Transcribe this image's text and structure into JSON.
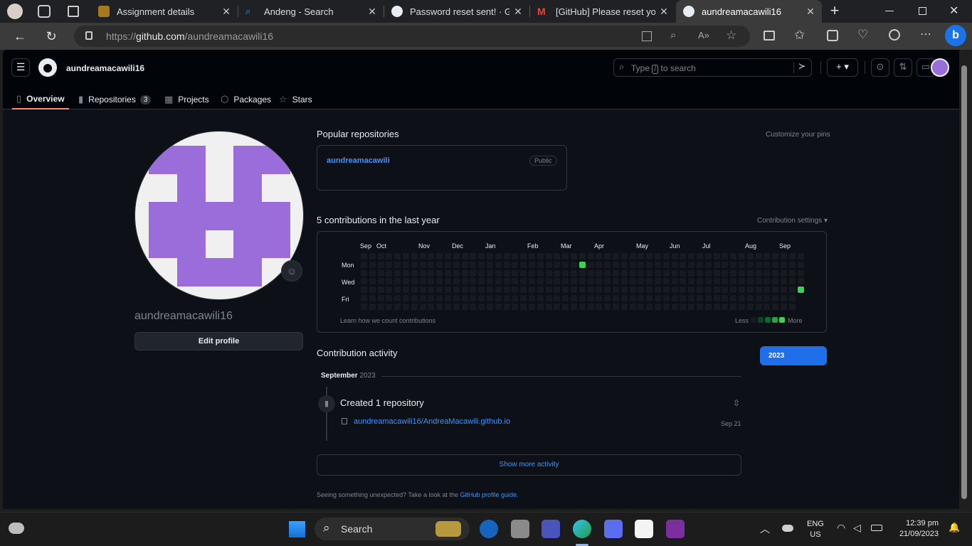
{
  "browser": {
    "tabs": [
      {
        "label": "Assignment details",
        "icon": "classroom-icon",
        "color": "#a5791d"
      },
      {
        "label": "Andeng - Search",
        "icon": "search-icon",
        "color": "#4b9cf5"
      },
      {
        "label": "Password reset sent! · GitH",
        "icon": "github-icon",
        "color": "#e6edf3"
      },
      {
        "label": "[GitHub] Please reset your",
        "icon": "gmail-icon",
        "color": "#ea4335"
      },
      {
        "label": "aundreamacawili16",
        "icon": "github-icon",
        "color": "#e6edf3"
      }
    ],
    "url_scheme": "https://",
    "url_host": "github.com",
    "url_path": "/aundreamacawili16"
  },
  "header": {
    "username": "aundreamacawili16",
    "search_placeholder_pre": "Type",
    "search_key": "/",
    "search_placeholder_post": "to search"
  },
  "nav": {
    "tabs": [
      {
        "label": "Overview",
        "icon": "book-icon"
      },
      {
        "label": "Repositories",
        "icon": "repo-icon",
        "count": "3"
      },
      {
        "label": "Projects",
        "icon": "table-icon"
      },
      {
        "label": "Packages",
        "icon": "package-icon"
      },
      {
        "label": "Stars",
        "icon": "star-icon"
      }
    ]
  },
  "profile": {
    "username": "aundreamacawili16",
    "edit_button": "Edit profile",
    "avatar_color": "#9b6ddb"
  },
  "popular": {
    "title": "Popular repositories",
    "customize": "Customize your pins",
    "repo_name": "aundreamacawili",
    "repo_visibility": "Public"
  },
  "contributions": {
    "title": "5 contributions in the last year",
    "settings": "Contribution settings ▾",
    "months": [
      "Sep",
      "Oct",
      "Nov",
      "Dec",
      "Jan",
      "Feb",
      "Mar",
      "Apr",
      "May",
      "Jun",
      "Jul",
      "Aug",
      "Sep"
    ],
    "days": [
      "Mon",
      "Wed",
      "Fri"
    ],
    "learn": "Learn how we count contributions",
    "less": "Less",
    "more": "More",
    "highlight_color": "#39d353"
  },
  "activity": {
    "title": "Contribution activity",
    "month": "September",
    "year": "2023",
    "year_button": "2023",
    "event_title": "Created 1 repository",
    "event_repo": "aundreamacawili16/AndreaMacawili.github.io",
    "event_date": "Sep 21",
    "show_more": "Show more activity",
    "footer_text": "Seeing something unexpected? Take a look at the",
    "footer_link": "GitHub profile guide."
  },
  "taskbar": {
    "search": "Search",
    "lang1": "ENG",
    "lang2": "US",
    "time": "12:39 pm",
    "date": "21/09/2023"
  }
}
